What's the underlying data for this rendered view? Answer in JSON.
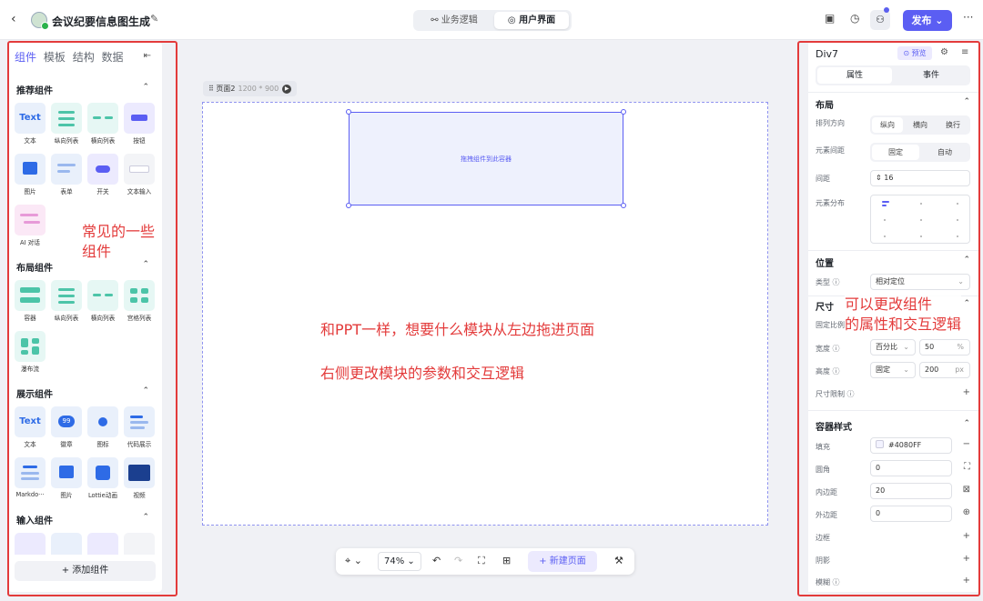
{
  "topbar": {
    "title": "会议纪要信息图生成",
    "tabs": [
      "业务逻辑",
      "用户界面"
    ],
    "publish": "发布"
  },
  "left": {
    "tabs": [
      "组件",
      "模板",
      "结构",
      "数据"
    ],
    "sections": [
      {
        "title": "推荐组件",
        "items": [
          "文本",
          "纵向列表",
          "横向列表",
          "按钮",
          "图片",
          "表单",
          "开关",
          "文本输入",
          "AI 对话"
        ]
      },
      {
        "title": "布局组件",
        "items": [
          "容器",
          "纵向列表",
          "横向列表",
          "宫格列表",
          "瀑布流"
        ]
      },
      {
        "title": "展示组件",
        "items": [
          "文本",
          "徽章",
          "图标",
          "代码展示",
          "Markdo···",
          "图片",
          "Lottie动画",
          "视频"
        ]
      },
      {
        "title": "输入组件",
        "items": []
      }
    ],
    "thumb_texts": {
      "text": "Text",
      "badge": "99"
    },
    "add_component": "添加组件"
  },
  "annotations": {
    "left": "常见的一些\n组件",
    "center1": "和PPT一样，想要什么模块从左边拖进页面",
    "center2": "右侧更改模块的参数和交互逻辑",
    "right": "可以更改组件\n的属性和交互逻辑"
  },
  "canvas": {
    "page_name": "页面2",
    "page_size": "1200 * 900",
    "container_hint": "拖拽组件到此容器"
  },
  "bottombar": {
    "zoom": "74%",
    "new_page": "新建页面"
  },
  "right": {
    "title": "Div7",
    "preview": "预览",
    "tabs": [
      "属性",
      "事件"
    ],
    "layout": {
      "title": "布局",
      "direction_label": "排列方向",
      "direction_options": [
        "纵向",
        "横向",
        "换行"
      ],
      "spacing_label": "元素间距",
      "spacing_options": [
        "固定",
        "自动"
      ],
      "gap_label": "间距",
      "gap_value": "16",
      "distribution_label": "元素分布"
    },
    "position": {
      "title": "位置",
      "type_label": "类型",
      "type_value": "相对定位"
    },
    "size": {
      "title": "尺寸",
      "ratio_label": "固定比例",
      "width_label": "宽度",
      "width_mode": "百分比",
      "width_value": "50",
      "width_unit": "%",
      "height_label": "高度",
      "height_mode": "固定",
      "height_value": "200",
      "height_unit": "px",
      "limit_label": "尺寸限制"
    },
    "style": {
      "title": "容器样式",
      "fill_label": "填充",
      "fill_value": "#4080FF",
      "radius_label": "圆角",
      "radius_value": "0",
      "padding_label": "内边距",
      "padding_value": "20",
      "margin_label": "外边距",
      "margin_value": "0",
      "border_label": "边框",
      "shadow_label": "阴影",
      "blur_label": "模糊"
    }
  },
  "colors": {
    "accent": "#5B5EF3",
    "annotation": "#E33B3B"
  }
}
